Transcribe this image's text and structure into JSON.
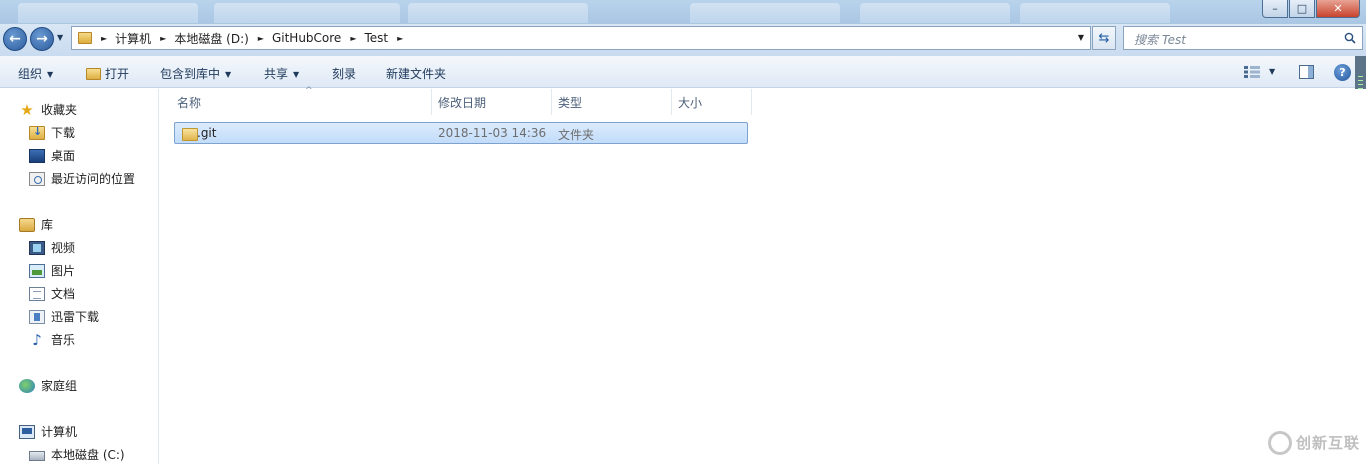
{
  "window": {
    "controls": {
      "minimize": "–",
      "maximize": "□",
      "close": "✕"
    }
  },
  "address_bar": {
    "crumbs": [
      "计算机",
      "本地磁盘 (D:)",
      "GitHubCore",
      "Test"
    ],
    "separator": "►",
    "back_glyph": "←",
    "forward_glyph": "→",
    "refresh_glyph": "⇆",
    "dropdown_glyph": "▼"
  },
  "search": {
    "placeholder": "搜索 Test"
  },
  "toolbar": {
    "organize": "组织",
    "open": "打开",
    "include_in_library": "包含到库中",
    "share": "共享",
    "burn": "刻录",
    "new_folder": "新建文件夹",
    "dropdown_glyph": "▼",
    "help": "?"
  },
  "navigation": {
    "favorites": {
      "label": "收藏夹",
      "items": [
        "下载",
        "桌面",
        "最近访问的位置"
      ]
    },
    "libraries": {
      "label": "库",
      "items": [
        "视频",
        "图片",
        "文档",
        "迅雷下载",
        "音乐"
      ]
    },
    "homegroup": {
      "label": "家庭组"
    },
    "computer": {
      "label": "计算机",
      "items": [
        "本地磁盘 (C:)"
      ]
    }
  },
  "file_list": {
    "columns": [
      "名称",
      "修改日期",
      "类型",
      "大小"
    ],
    "sort_indicator": "^",
    "rows": [
      {
        "name": ".git",
        "modified": "2018-11-03 14:36",
        "type": "文件夹",
        "size": "",
        "selected": true
      }
    ]
  },
  "watermark": {
    "text": "创新互联"
  },
  "colors": {
    "selection": "#cce4fc",
    "accent": "#1e395b",
    "nav_blue": "#2c5c9c"
  }
}
